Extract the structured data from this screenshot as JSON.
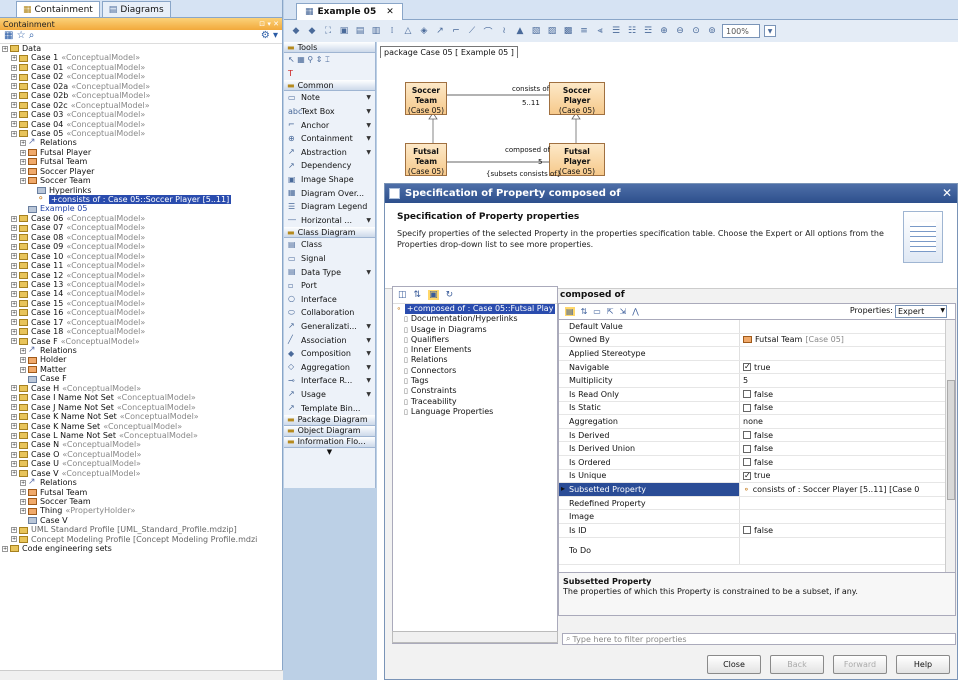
{
  "left_tabs": [
    "Containment",
    "Diagrams"
  ],
  "containment_header": "Containment",
  "tree": [
    {
      "indent": 0,
      "icon": "fold",
      "label": "Data",
      "stereo": ""
    },
    {
      "indent": 1,
      "icon": "fold",
      "label": "Case 1",
      "stereo": "«ConceptualModel»"
    },
    {
      "indent": 1,
      "icon": "fold",
      "label": "Case 01",
      "stereo": "«ConceptualModel»"
    },
    {
      "indent": 1,
      "icon": "fold",
      "label": "Case 02",
      "stereo": "«ConceptualModel»"
    },
    {
      "indent": 1,
      "icon": "fold",
      "label": "Case 02a",
      "stereo": "«ConceptualModel»"
    },
    {
      "indent": 1,
      "icon": "fold",
      "label": "Case 02b",
      "stereo": "«ConceptualModel»"
    },
    {
      "indent": 1,
      "icon": "fold",
      "label": "Case 02c",
      "stereo": "«ConceptualModel»"
    },
    {
      "indent": 1,
      "icon": "fold",
      "label": "Case 03",
      "stereo": "«ConceptualModel»"
    },
    {
      "indent": 1,
      "icon": "fold",
      "label": "Case 04",
      "stereo": "«ConceptualModel»"
    },
    {
      "indent": 1,
      "icon": "fold",
      "label": "Case 05",
      "stereo": "«ConceptualModel»"
    },
    {
      "indent": 2,
      "icon": "rel",
      "label": "Relations",
      "stereo": ""
    },
    {
      "indent": 2,
      "icon": "cls",
      "label": "Futsal Player",
      "stereo": ""
    },
    {
      "indent": 2,
      "icon": "cls",
      "label": "Futsal Team",
      "stereo": ""
    },
    {
      "indent": 2,
      "icon": "cls",
      "label": "Soccer Player",
      "stereo": ""
    },
    {
      "indent": 2,
      "icon": "cls",
      "label": "Soccer Team",
      "stereo": ""
    },
    {
      "indent": 3,
      "icon": "diag",
      "label": "Hyperlinks",
      "stereo": ""
    },
    {
      "indent": 3,
      "icon": "prop",
      "label": "+consists of : Case 05::Soccer Player [5..11]",
      "stereo": "",
      "selected": true
    },
    {
      "indent": 2,
      "icon": "diag",
      "label": "Example 05",
      "stereo": "",
      "blue": true
    },
    {
      "indent": 1,
      "icon": "fold",
      "label": "Case 06",
      "stereo": "«ConceptualModel»"
    },
    {
      "indent": 1,
      "icon": "fold",
      "label": "Case 07",
      "stereo": "«ConceptualModel»"
    },
    {
      "indent": 1,
      "icon": "fold",
      "label": "Case 08",
      "stereo": "«ConceptualModel»"
    },
    {
      "indent": 1,
      "icon": "fold",
      "label": "Case 09",
      "stereo": "«ConceptualModel»"
    },
    {
      "indent": 1,
      "icon": "fold",
      "label": "Case 10",
      "stereo": "«ConceptualModel»"
    },
    {
      "indent": 1,
      "icon": "fold",
      "label": "Case 11",
      "stereo": "«ConceptualModel»"
    },
    {
      "indent": 1,
      "icon": "fold",
      "label": "Case 12",
      "stereo": "«ConceptualModel»"
    },
    {
      "indent": 1,
      "icon": "fold",
      "label": "Case 13",
      "stereo": "«ConceptualModel»"
    },
    {
      "indent": 1,
      "icon": "fold",
      "label": "Case 14",
      "stereo": "«ConceptualModel»"
    },
    {
      "indent": 1,
      "icon": "fold",
      "label": "Case 15",
      "stereo": "«ConceptualModel»"
    },
    {
      "indent": 1,
      "icon": "fold",
      "label": "Case 16",
      "stereo": "«ConceptualModel»"
    },
    {
      "indent": 1,
      "icon": "fold",
      "label": "Case 17",
      "stereo": "«ConceptualModel»"
    },
    {
      "indent": 1,
      "icon": "fold",
      "label": "Case 18",
      "stereo": "«ConceptualModel»"
    },
    {
      "indent": 1,
      "icon": "fold",
      "label": "Case F",
      "stereo": "«ConceptualModel»"
    },
    {
      "indent": 2,
      "icon": "rel",
      "label": "Relations",
      "stereo": ""
    },
    {
      "indent": 2,
      "icon": "cls",
      "label": "Holder",
      "stereo": ""
    },
    {
      "indent": 2,
      "icon": "cls",
      "label": "Matter",
      "stereo": ""
    },
    {
      "indent": 2,
      "icon": "diag",
      "label": "Case F",
      "stereo": ""
    },
    {
      "indent": 1,
      "icon": "fold",
      "label": "Case H",
      "stereo": "«ConceptualModel»"
    },
    {
      "indent": 1,
      "icon": "fold",
      "label": "Case I Name Not Set",
      "stereo": "«ConceptualModel»"
    },
    {
      "indent": 1,
      "icon": "fold",
      "label": "Case J Name Not Set",
      "stereo": "«ConceptualModel»"
    },
    {
      "indent": 1,
      "icon": "fold",
      "label": "Case K Name Not Set",
      "stereo": "«ConceptualModel»"
    },
    {
      "indent": 1,
      "icon": "fold",
      "label": "Case K Name Set",
      "stereo": "«ConceptualModel»"
    },
    {
      "indent": 1,
      "icon": "fold",
      "label": "Case L Name Not Set",
      "stereo": "«ConceptualModel»"
    },
    {
      "indent": 1,
      "icon": "fold",
      "label": "Case N",
      "stereo": "«ConceptualModel»"
    },
    {
      "indent": 1,
      "icon": "fold",
      "label": "Case O",
      "stereo": "«ConceptualModel»"
    },
    {
      "indent": 1,
      "icon": "fold",
      "label": "Case U",
      "stereo": "«ConceptualModel»"
    },
    {
      "indent": 1,
      "icon": "fold",
      "label": "Case V",
      "stereo": "«ConceptualModel»"
    },
    {
      "indent": 2,
      "icon": "rel",
      "label": "Relations",
      "stereo": ""
    },
    {
      "indent": 2,
      "icon": "cls",
      "label": "Futsal Team",
      "stereo": ""
    },
    {
      "indent": 2,
      "icon": "cls",
      "label": "Soccer Team",
      "stereo": ""
    },
    {
      "indent": 2,
      "icon": "cls",
      "label": "Thing",
      "stereo": "«PropertyHolder»"
    },
    {
      "indent": 2,
      "icon": "diag",
      "label": "Case V",
      "stereo": ""
    },
    {
      "indent": 1,
      "icon": "fold",
      "label": "UML Standard Profile [UML_Standard_Profile.mdzip]",
      "stereo": "",
      "grey": true
    },
    {
      "indent": 1,
      "icon": "fold",
      "label": "Concept Modeling Profile [Concept Modeling Profile.mdzi",
      "stereo": "",
      "grey": true
    },
    {
      "indent": 0,
      "icon": "fold",
      "label": "Code engineering sets",
      "stereo": ""
    }
  ],
  "diagram_tab": "Example 05",
  "zoom": "100%",
  "palette": {
    "groups": [
      {
        "title": "Tools",
        "items": []
      },
      {
        "title": "Common",
        "items": [
          "Note",
          "Text Box",
          "Anchor",
          "Containment",
          "Abstraction",
          "Dependency",
          "Image Shape",
          "Diagram Over...",
          "Diagram Legend",
          "Horizontal ..."
        ]
      },
      {
        "title": "Class Diagram",
        "items": [
          "Class",
          "Signal",
          "Data Type",
          "Port",
          "Interface",
          "Collaboration",
          "Generalizati...",
          "Association",
          "Composition",
          "Aggregation",
          "Interface R...",
          "Usage",
          "Template Bin..."
        ]
      },
      {
        "title": "Package Diagram",
        "items": []
      },
      {
        "title": "Object Diagram",
        "items": []
      },
      {
        "title": "Information Flo...",
        "items": []
      }
    ]
  },
  "package_header": "package Case 05 [  Example 05 ]",
  "diagram": {
    "soccer_team": {
      "name": "Soccer Team",
      "sub": "(Case 05)"
    },
    "soccer_player": {
      "name": "Soccer Player",
      "sub": "(Case 05)"
    },
    "futsal_team": {
      "name": "Futsal Team",
      "sub": "(Case 05)"
    },
    "futsal_player": {
      "name": "Futsal Player",
      "sub": "(Case 05)"
    },
    "consists_of": "consists of",
    "consists_mult": "5..11",
    "composed_of": "composed of",
    "composed_mult": "5",
    "subsets_note": "{subsets consists of}"
  },
  "dialog": {
    "title": "Specification of Property composed of",
    "header_title": "Specification of Property properties",
    "header_text": "Specify properties of the selected Property in the properties specification table. Choose the Expert or All options from the Properties drop-down list to see more properties.",
    "left_tree": [
      "+composed of : Case 05::Futsal Play",
      "Documentation/Hyperlinks",
      "Usage in Diagrams",
      "Qualifiers",
      "Inner Elements",
      "Relations",
      "Connectors",
      "Tags",
      "Constraints",
      "Traceability",
      "Language Properties"
    ],
    "right_title": "composed of",
    "properties_label": "Properties:",
    "properties_value": "Expert",
    "rows": [
      {
        "name": "Default Value",
        "value": "",
        "type": "text"
      },
      {
        "name": "Owned By",
        "value": "Futsal Team",
        "suffix": "[Case 05]",
        "type": "ref"
      },
      {
        "name": "Applied Stereotype",
        "value": "",
        "type": "text"
      },
      {
        "name": "Navigable",
        "value": "true",
        "type": "check",
        "checked": true
      },
      {
        "name": "Multiplicity",
        "value": "5",
        "type": "text"
      },
      {
        "name": "Is Read Only",
        "value": "false",
        "type": "check",
        "checked": false
      },
      {
        "name": "Is Static",
        "value": "false",
        "type": "check",
        "checked": false
      },
      {
        "name": "Aggregation",
        "value": "none",
        "type": "text"
      },
      {
        "name": "Is Derived",
        "value": "false",
        "type": "check",
        "checked": false
      },
      {
        "name": "Is Derived Union",
        "value": "false",
        "type": "check",
        "checked": false
      },
      {
        "name": "Is Ordered",
        "value": "false",
        "type": "check",
        "checked": false
      },
      {
        "name": "Is Unique",
        "value": "true",
        "type": "check",
        "checked": true
      },
      {
        "name": "Subsetted Property",
        "value": "consists of : Soccer Player [5..11] [Case 0",
        "type": "prop",
        "highlight": true
      },
      {
        "name": "Redefined Property",
        "value": "",
        "type": "text"
      },
      {
        "name": "Image",
        "value": "",
        "type": "text"
      },
      {
        "name": "Is ID",
        "value": "false",
        "type": "check",
        "checked": false
      },
      {
        "name": "To Do",
        "value": "",
        "type": "tall"
      }
    ],
    "desc_title": "Subsetted Property",
    "desc_text": "The properties of which this Property is constrained to be a subset, if any.",
    "filter_placeholder": "Type here to filter properties",
    "buttons": {
      "close": "Close",
      "back": "Back",
      "forward": "Forward",
      "help": "Help"
    }
  }
}
